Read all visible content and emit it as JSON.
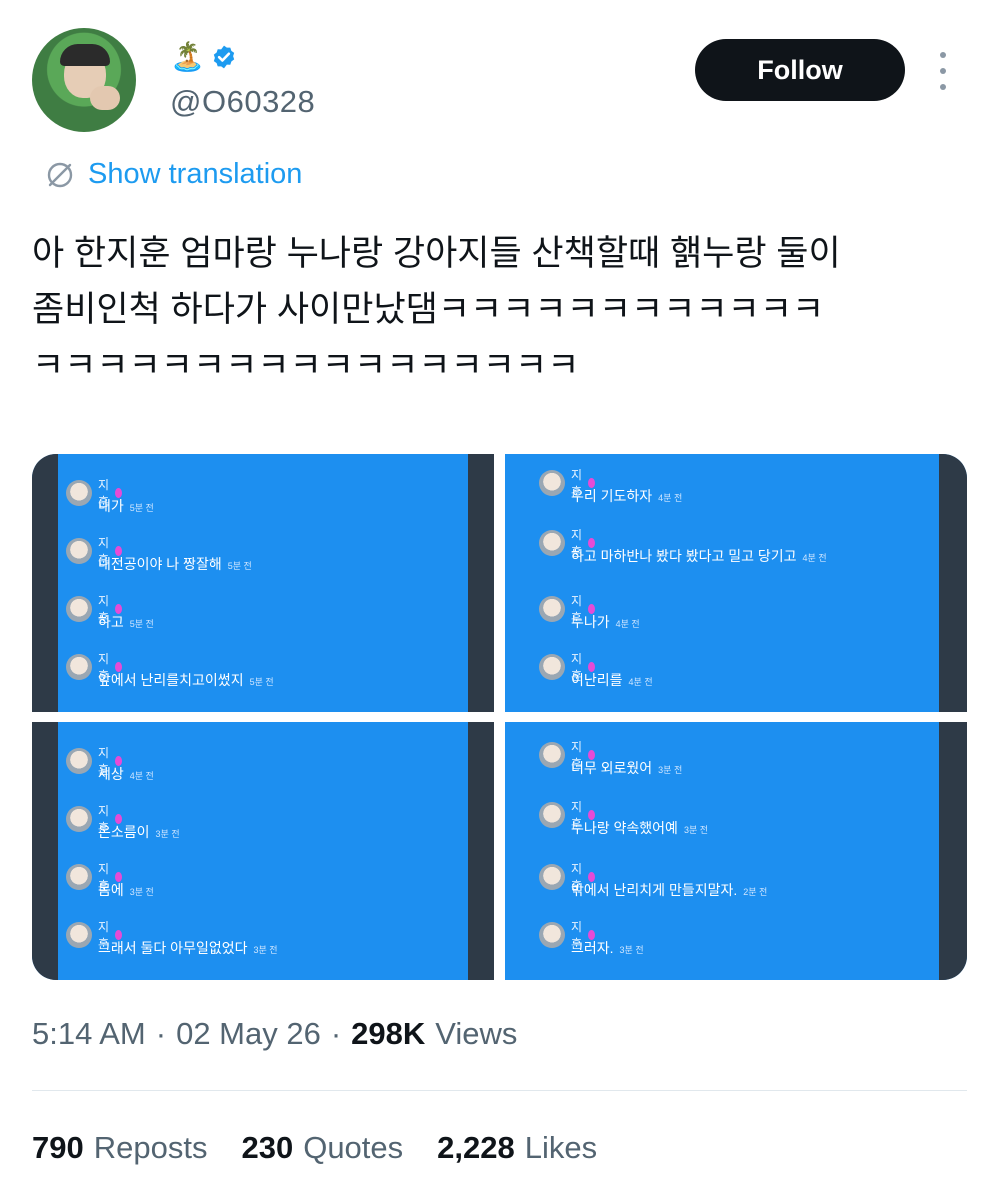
{
  "user": {
    "display_emoji": "🏝️",
    "handle": "@O60328",
    "follow_label": "Follow"
  },
  "translate": {
    "label": "Show translation"
  },
  "tweet": {
    "text": "아 한지훈 엄마랑 누나랑 강아지들 산책할때 핽누랑 둘이\n좀비인척 하다가 사이만났댐ㅋㅋㅋㅋㅋㅋㅋㅋㅋㅋㅋㅋ\nㅋㅋㅋㅋㅋㅋㅋㅋㅋㅋㅋㅋㅋㅋㅋㅋㅋ"
  },
  "media": {
    "panels": [
      {
        "messages": [
          {
            "sender": "지훈",
            "text": "내가",
            "time": "5분 전"
          },
          {
            "sender": "지훈",
            "text": "내전공이야 나 짱잘해",
            "time": "5분 전"
          },
          {
            "sender": "지훈",
            "text": "하고",
            "time": "5분 전"
          },
          {
            "sender": "지훈",
            "text": "앞에서 난리를치고이썼지",
            "time": "5분 전"
          }
        ]
      },
      {
        "messages": [
          {
            "sender": "지훈",
            "text": "우리 기도하자",
            "time": "4분 전"
          },
          {
            "sender": "지훈",
            "text": "하고 마하반나 봤다 봤다고 밀고 당기고",
            "time": "4분 전"
          },
          {
            "sender": "지훈",
            "text": "누나가",
            "time": "4분 전"
          },
          {
            "sender": "지훈",
            "text": "이난리를",
            "time": "4분 전"
          }
        ]
      },
      {
        "messages": [
          {
            "sender": "지훈",
            "text": "세상",
            "time": "4분 전"
          },
          {
            "sender": "지훈",
            "text": "온소름이",
            "time": "3분 전"
          },
          {
            "sender": "지훈",
            "text": "몸에",
            "time": "3분 전"
          },
          {
            "sender": "지훈",
            "text": "그래서 둘다 아무일없었다",
            "time": "3분 전"
          }
        ]
      },
      {
        "messages": [
          {
            "sender": "지훈",
            "text": "너무 외로웠어",
            "time": "3분 전"
          },
          {
            "sender": "지훈",
            "text": "누나랑 약속했어예",
            "time": "3분 전"
          },
          {
            "sender": "지훈",
            "text": "밖에서 난리치게 만들지말자.",
            "time": "2분 전"
          },
          {
            "sender": "지훈",
            "text": "그러자.",
            "time": "3분 전"
          }
        ]
      }
    ]
  },
  "meta": {
    "time": "5:14 AM",
    "sep1": "·",
    "date": "02 May 26",
    "sep2": "·",
    "views_count": "298K",
    "views_label": "Views"
  },
  "stats": {
    "reposts_count": "790",
    "reposts_label": "Reposts",
    "quotes_count": "230",
    "quotes_label": "Quotes",
    "likes_count": "2,228",
    "likes_label": "Likes"
  },
  "colors": {
    "accent": "#1d9bf0",
    "panel_blue": "#1d8ff0",
    "verified": "#1d9bf0",
    "badge_pink": "#e64bd6"
  }
}
